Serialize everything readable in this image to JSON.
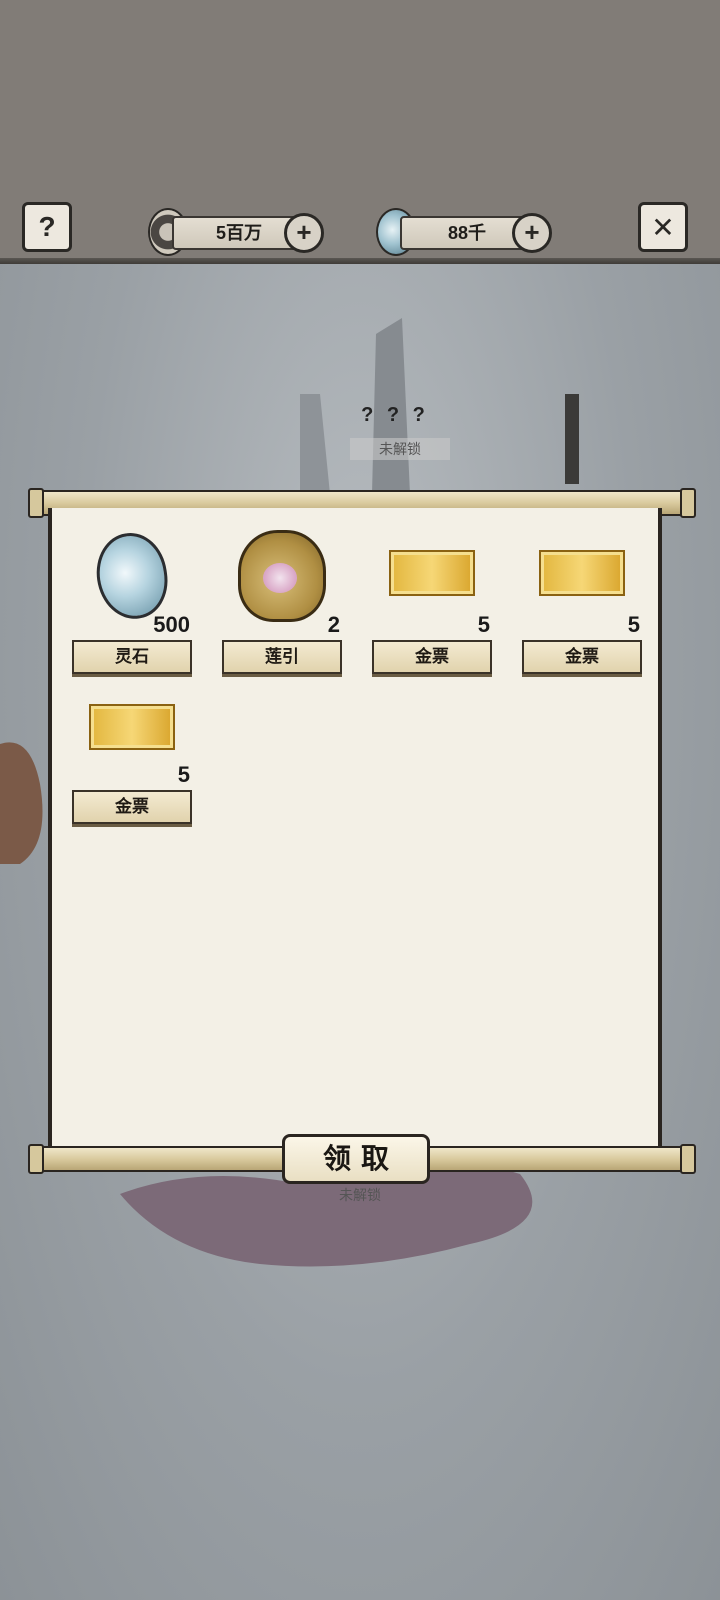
{
  "hud": {
    "help_icon": "question-mark-icon",
    "close_icon": "close-x-icon",
    "coins": {
      "value": "5百万",
      "icon": "copper-coin-icon"
    },
    "spirit_stones": {
      "value": "88千",
      "icon": "spirit-stone-icon"
    },
    "add_symbol": "+"
  },
  "scene": {
    "locked_title": "? ? ?",
    "locked_label": "未解锁",
    "locked_label_2": "未解锁"
  },
  "rewards": {
    "items": [
      {
        "name": "灵石",
        "count": "500",
        "icon": "spirit-stone-icon"
      },
      {
        "name": "莲引",
        "count": "2",
        "icon": "lotus-bag-icon"
      },
      {
        "name": "金票",
        "count": "5",
        "icon": "gold-ticket-icon"
      },
      {
        "name": "金票",
        "count": "5",
        "icon": "gold-ticket-icon"
      },
      {
        "name": "金票",
        "count": "5",
        "icon": "gold-ticket-icon"
      }
    ],
    "claim_label": "领取"
  }
}
